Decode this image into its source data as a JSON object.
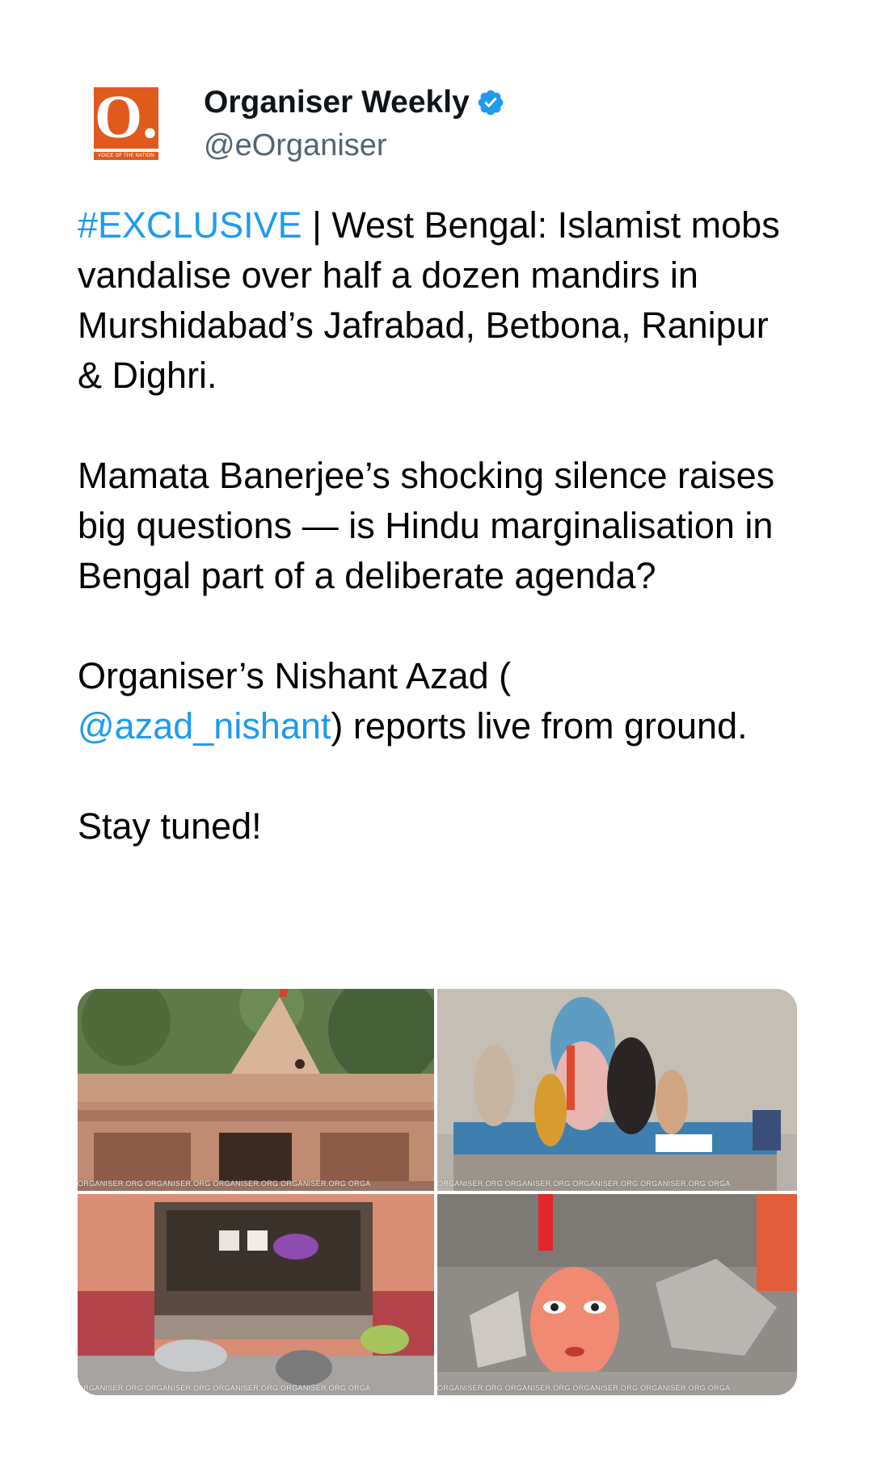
{
  "account": {
    "name": "Organiser Weekly",
    "handle": "@eOrganiser",
    "logo_letter": "O.",
    "logo_tagline": "VOICE OF THE NATION",
    "logo_color": "#e05a1e",
    "verified_color": "#1d9bf0",
    "verified_icon": "verified-badge-icon"
  },
  "tweet": {
    "hashtag": "#EXCLUSIVE",
    "p1_rest": " | West Bengal: Islamist mobs vandalise over half a dozen mandirs in Murshidabad’s Jafrabad, Betbona, Ranipur & Dighri.",
    "p2": "Mamata Banerjee’s shocking silence raises big questions — is Hindu marginalisation in Bengal part of a deliberate agenda?",
    "p3_before": "Organiser’s Nishant Azad (",
    "mention": "@azad_nishant",
    "p3_after": ") reports live from ground.",
    "p4": "Stay tuned!",
    "link_color": "#1d9bf0"
  },
  "media": {
    "watermark": "ORGANISER.ORG   ORGANISER.ORG   ORGANISER.ORG   ORGANISER.ORG   ORGA",
    "images": [
      {
        "subject": "vandalised temple exterior"
      },
      {
        "subject": "damaged idols inside shrine"
      },
      {
        "subject": "ransacked shrine interior"
      },
      {
        "subject": "broken idol face among debris"
      }
    ]
  }
}
